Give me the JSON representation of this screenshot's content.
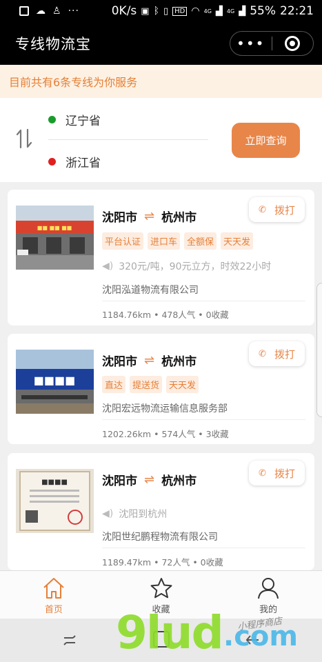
{
  "status_bar": {
    "speed": "0K/s",
    "signal_1": "4G",
    "signal_2": "4G",
    "battery": "55%",
    "time": "22:21",
    "hd_label": "HD"
  },
  "app": {
    "title": "专线物流宝",
    "more_label": "•••"
  },
  "notice": {
    "text": "目前共有6条专线为你服务"
  },
  "route": {
    "from": "辽宁省",
    "to": "浙江省",
    "from_dot_color": "#1a9c2c",
    "to_dot_color": "#e02020",
    "query_button": "立即查询"
  },
  "cards": [
    {
      "from_city": "沈阳市",
      "to_city": "杭州市",
      "call_label": "拨打",
      "tags": [
        "平台认证",
        "进口车",
        "全额保",
        "天天发"
      ],
      "desc": "320元/吨，90元立方，时效22小时",
      "company": "沈阳泓道物流有限公司",
      "distance": "1184.76km",
      "popularity": "478人气",
      "favorites": "0收藏"
    },
    {
      "from_city": "沈阳市",
      "to_city": "杭州市",
      "call_label": "拨打",
      "tags": [
        "直达",
        "提送货",
        "天天发"
      ],
      "desc": "",
      "company": "沈阳宏远物流运输信息服务部",
      "distance": "1202.26km",
      "popularity": "574人气",
      "favorites": "3收藏"
    },
    {
      "from_city": "沈阳市",
      "to_city": "杭州市",
      "call_label": "拨打",
      "tags": [],
      "desc": "沈阳到杭州",
      "company": "沈阳世纪鹏程物流有限公司",
      "distance": "1189.47km",
      "popularity": "72人气",
      "favorites": "0收藏"
    }
  ],
  "tabs": [
    {
      "label": "首页",
      "icon": "home-icon",
      "active": true
    },
    {
      "label": "收藏",
      "icon": "star-icon",
      "active": false
    },
    {
      "label": "我的",
      "icon": "user-icon",
      "active": false
    }
  ],
  "watermark": {
    "main": "9lud",
    "suffix": ".com",
    "handwriting": "小程序商店"
  },
  "colors": {
    "accent": "#e8864a",
    "notice_bg": "#fdf1e3",
    "tag_bg": "#fdece0"
  }
}
